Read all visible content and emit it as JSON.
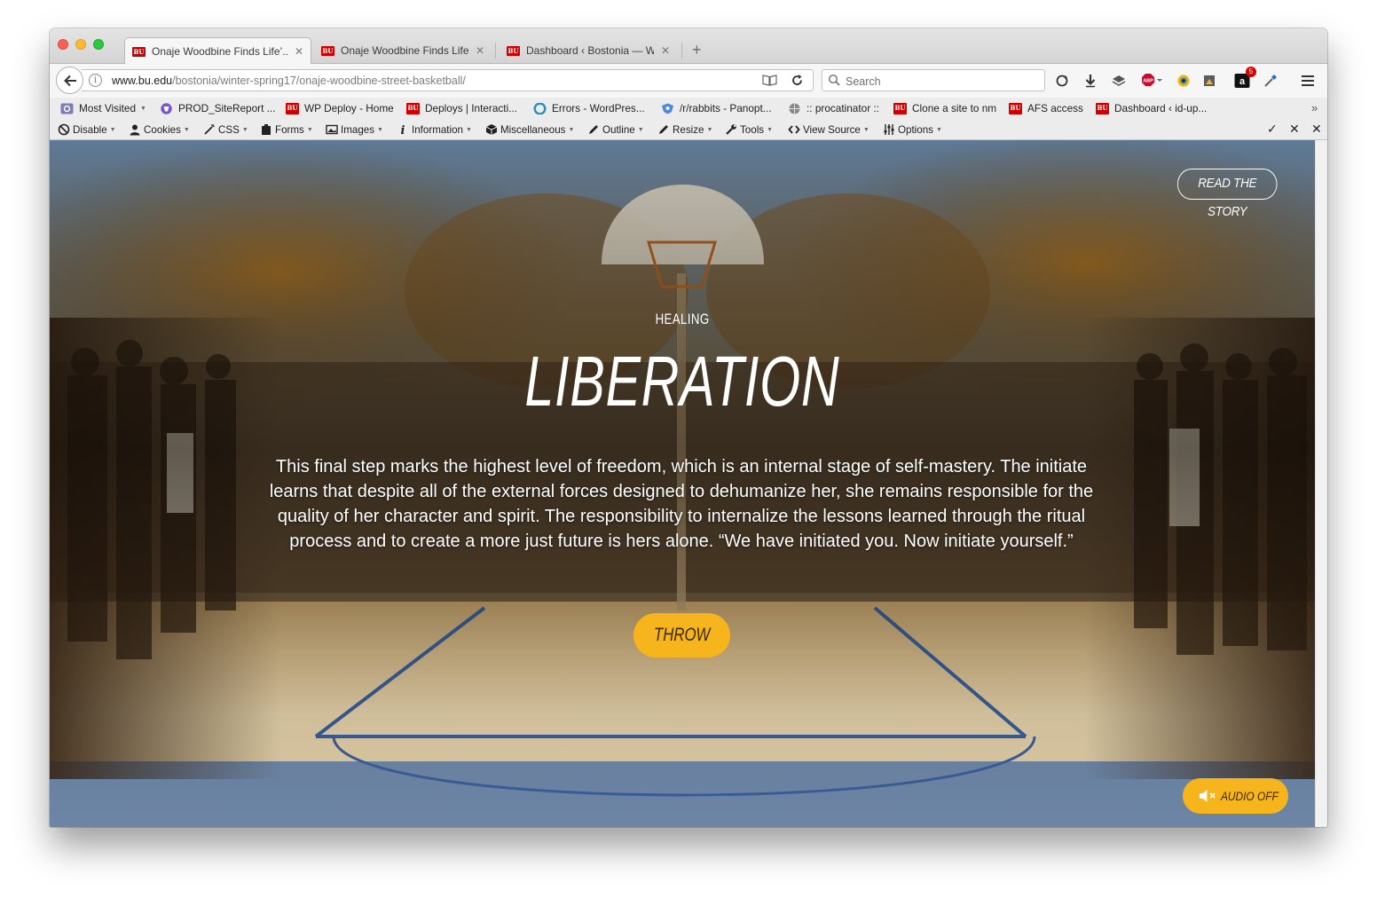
{
  "browser": {
    "tabs": [
      {
        "title": "Onaje Woodbine Finds Life’...",
        "active": true
      },
      {
        "title": "Onaje Woodbine Finds Life’...",
        "active": false
      },
      {
        "title": "Dashboard ‹ Bostonia — W...",
        "active": false
      }
    ],
    "url": {
      "domain": "www.bu.edu",
      "path": "/bostonia/winter-spring17/onaje-woodbine-street-basketball/"
    },
    "search_placeholder": "Search",
    "downloads_badge": "5"
  },
  "bookmarks": [
    {
      "label": "Most Visited",
      "icon": "gear-icon",
      "dropdown": true
    },
    {
      "label": "PROD_SiteReport ...",
      "icon": "shield-icon"
    },
    {
      "label": "WP Deploy - Home",
      "icon": "bu-logo"
    },
    {
      "label": "Deploys | Interacti...",
      "icon": "bu-logo"
    },
    {
      "label": "Errors - WordPres...",
      "icon": "circle-icon"
    },
    {
      "label": "/r/rabbits - Panopt...",
      "icon": "shield-icon"
    },
    {
      "label": ":: procatinator ::",
      "icon": "globe-icon"
    },
    {
      "label": "Clone a site to nm",
      "icon": "bu-logo"
    },
    {
      "label": "AFS access",
      "icon": "bu-logo"
    },
    {
      "label": "Dashboard ‹ id-up...",
      "icon": "bu-logo"
    }
  ],
  "devtools": [
    {
      "label": "Disable",
      "icon": "disable-icon"
    },
    {
      "label": "Cookies",
      "icon": "cookie-user-icon"
    },
    {
      "label": "CSS",
      "icon": "css-wand-icon"
    },
    {
      "label": "Forms",
      "icon": "forms-icon"
    },
    {
      "label": "Images",
      "icon": "images-icon"
    },
    {
      "label": "Information",
      "icon": "info-icon"
    },
    {
      "label": "Miscellaneous",
      "icon": "cube-icon"
    },
    {
      "label": "Outline",
      "icon": "pencil-icon"
    },
    {
      "label": "Resize",
      "icon": "pencil-icon"
    },
    {
      "label": "Tools",
      "icon": "wrench-icon"
    },
    {
      "label": "View Source",
      "icon": "code-icon"
    },
    {
      "label": "Options",
      "icon": "sliders-icon"
    }
  ],
  "page": {
    "read_story": "READ THE STORY",
    "kicker": "HEALING",
    "headline": "LIBERATION",
    "body": "This final step marks the highest level of freedom, which is an internal stage of self-mastery. The initiate learns that despite all of the external forces designed to dehumanize her, she remains responsible for the quality of her character and spirit. The responsibility to internalize the lessons learned through the ritual process and to create a more just future is hers alone. “We have initiated you. Now initiate yourself.”",
    "throw_button": "THROW",
    "audio_button": "AUDIO OFF",
    "accent_color": "#f6b41d"
  }
}
